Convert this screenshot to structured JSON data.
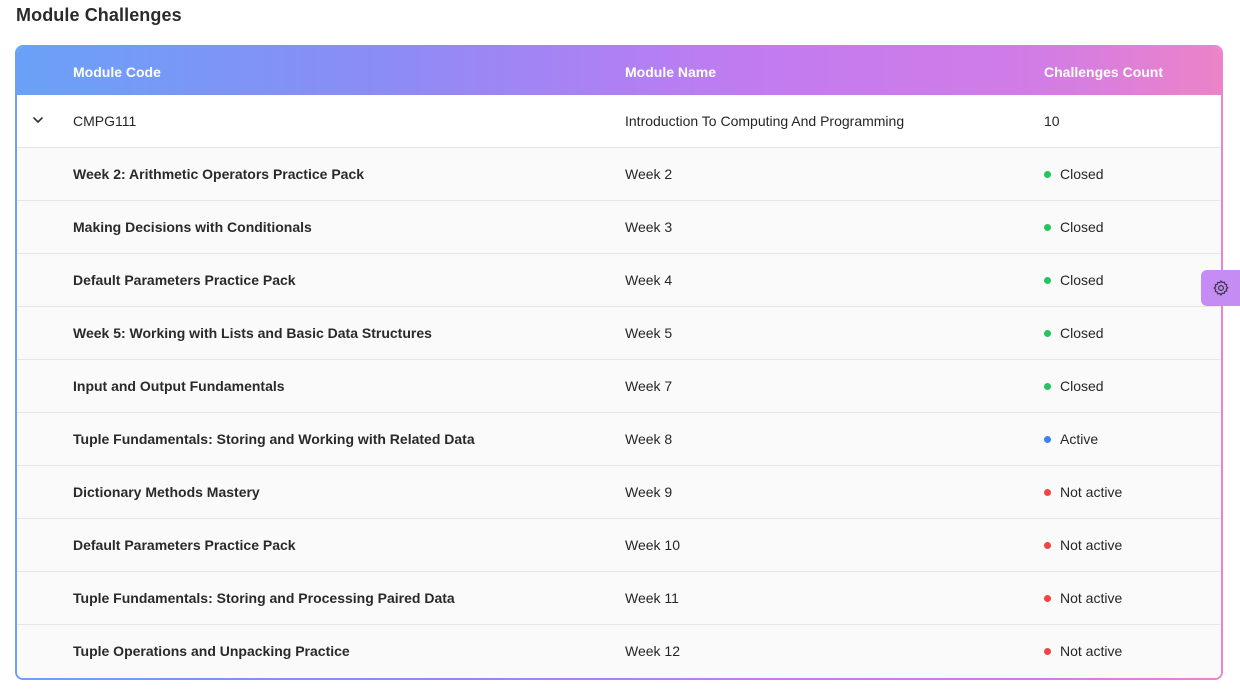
{
  "page": {
    "title": "Module Challenges"
  },
  "table": {
    "headers": {
      "code": "Module Code",
      "name": "Module Name",
      "count": "Challenges Count"
    },
    "module": {
      "code": "CMPG111",
      "name": "Introduction To Computing And Programming",
      "count": "10",
      "expanded": true
    },
    "challenges": [
      {
        "title": "Week 2: Arithmetic Operators Practice Pack",
        "week": "Week 2",
        "status": "Closed"
      },
      {
        "title": "Making Decisions with Conditionals",
        "week": "Week 3",
        "status": "Closed"
      },
      {
        "title": "Default Parameters Practice Pack",
        "week": "Week 4",
        "status": "Closed"
      },
      {
        "title": "Week 5: Working with Lists and Basic Data Structures",
        "week": "Week 5",
        "status": "Closed"
      },
      {
        "title": "Input and Output Fundamentals",
        "week": "Week 7",
        "status": "Closed"
      },
      {
        "title": "Tuple Fundamentals: Storing and Working with Related Data",
        "week": "Week 8",
        "status": "Active"
      },
      {
        "title": "Dictionary Methods Mastery",
        "week": "Week 9",
        "status": "Not active"
      },
      {
        "title": "Default Parameters Practice Pack",
        "week": "Week 10",
        "status": "Not active"
      },
      {
        "title": "Tuple Fundamentals: Storing and Processing Paired Data",
        "week": "Week 11",
        "status": "Not active"
      },
      {
        "title": "Tuple Operations and Unpacking Practice",
        "week": "Week 12",
        "status": "Not active"
      }
    ]
  },
  "status_colors": {
    "Closed": "#22c55e",
    "Active": "#3b82f6",
    "Not active": "#ef4444"
  },
  "icons": {
    "expander": "chevron-down-icon",
    "settings": "gear-icon"
  }
}
